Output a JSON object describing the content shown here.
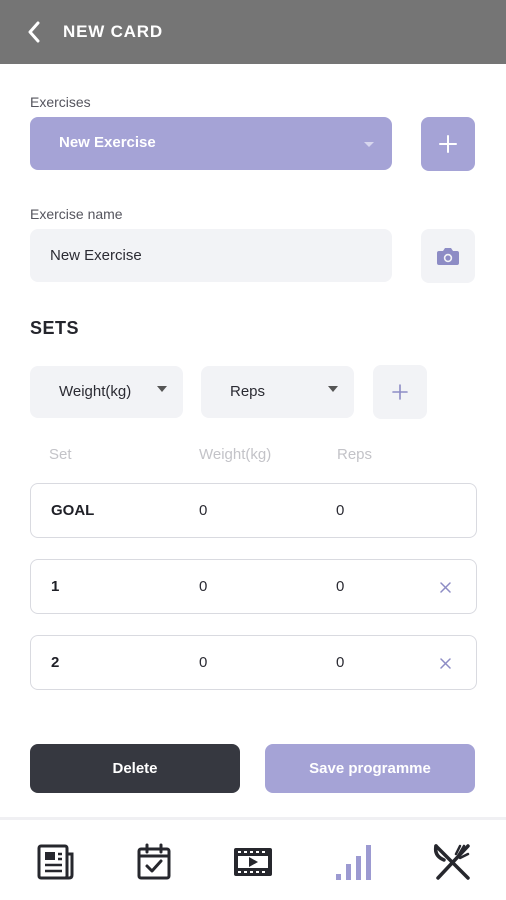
{
  "header": {
    "title": "NEW CARD",
    "back_icon": "chevron-left-icon"
  },
  "exercises": {
    "label": "Exercises",
    "selected": "New Exercise",
    "add_icon": "plus-icon"
  },
  "exercise_name": {
    "label": "Exercise name",
    "value": "New Exercise",
    "camera_icon": "camera-icon"
  },
  "sets": {
    "title": "SETS",
    "column_selects": [
      "Weight(kg)",
      "Reps"
    ],
    "add_column_icon": "plus-icon",
    "headers": [
      "Set",
      "Weight(kg)",
      "Reps"
    ],
    "rows": [
      {
        "set": "GOAL",
        "weight": "0",
        "reps": "0",
        "removable": false
      },
      {
        "set": "1",
        "weight": "0",
        "reps": "0",
        "removable": true
      },
      {
        "set": "2",
        "weight": "0",
        "reps": "0",
        "removable": true
      }
    ]
  },
  "actions": {
    "delete_label": "Delete",
    "save_label": "Save programme"
  },
  "nav": {
    "items": [
      {
        "icon": "news-icon",
        "active": false
      },
      {
        "icon": "calendar-check-icon",
        "active": false
      },
      {
        "icon": "video-icon",
        "active": false
      },
      {
        "icon": "bar-chart-icon",
        "active": true
      },
      {
        "icon": "fork-knife-icon",
        "active": false
      }
    ]
  },
  "colors": {
    "header": "#757575",
    "accent": "#a5a3d6",
    "dark_button": "#363840",
    "field_bg": "#f2f3f6"
  }
}
